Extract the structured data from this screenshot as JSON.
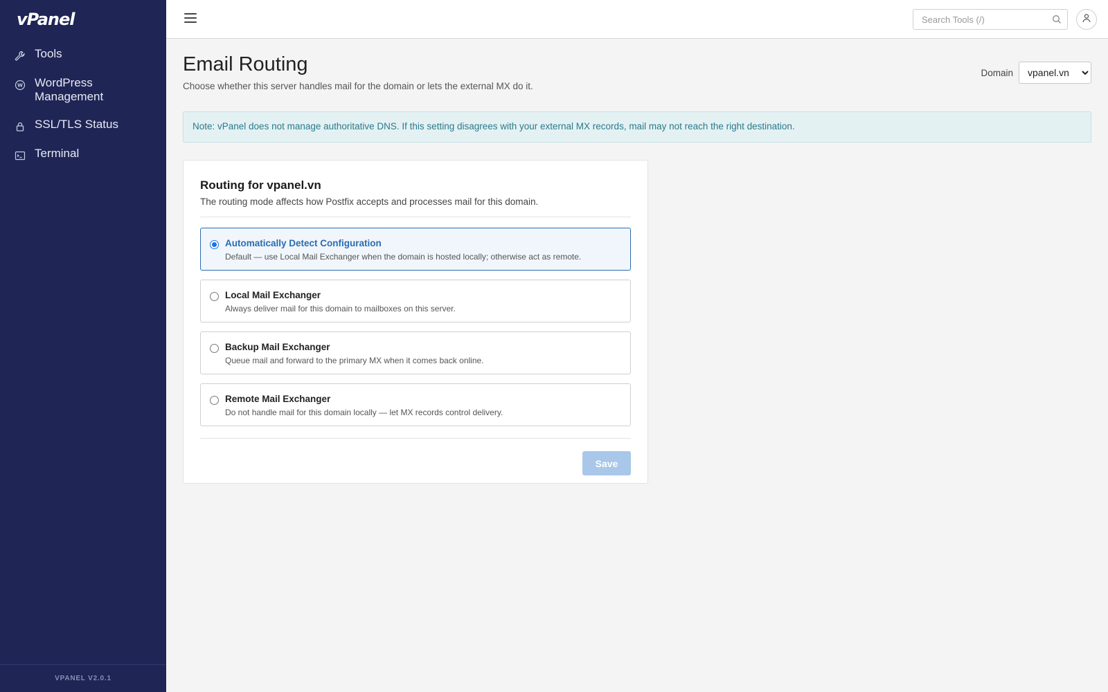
{
  "app": {
    "logo": "vPanel",
    "version": "VPANEL V2.0.1"
  },
  "sidebar": {
    "items": [
      {
        "label": "Tools",
        "icon": "wrench-icon"
      },
      {
        "label": "WordPress Management",
        "icon": "wordpress-icon"
      },
      {
        "label": "SSL/TLS Status",
        "icon": "lock-icon"
      },
      {
        "label": "Terminal",
        "icon": "terminal-icon"
      }
    ]
  },
  "topbar": {
    "search_placeholder": "Search Tools (/)",
    "search_value": ""
  },
  "page": {
    "title": "Email Routing",
    "subtitle": "Choose whether this server handles mail for the domain or lets the external MX do it.",
    "domain_label": "Domain",
    "domain_value": "vpanel.vn",
    "alert": "Note: vPanel does not manage authoritative DNS. If this setting disagrees with your external MX records, mail may not reach the right destination."
  },
  "card": {
    "title": "Routing for vpanel.vn",
    "description": "The routing mode affects how Postfix accepts and processes mail for this domain.",
    "options": [
      {
        "title": "Automatically Detect Configuration",
        "desc": "Default — use Local Mail Exchanger when the domain is hosted locally; otherwise act as remote.",
        "selected": true
      },
      {
        "title": "Local Mail Exchanger",
        "desc": "Always deliver mail for this domain to mailboxes on this server.",
        "selected": false
      },
      {
        "title": "Backup Mail Exchanger",
        "desc": "Queue mail and forward to the primary MX when it comes back online.",
        "selected": false
      },
      {
        "title": "Remote Mail Exchanger",
        "desc": "Do not handle mail for this domain locally — let MX records control delivery.",
        "selected": false
      }
    ],
    "save_label": "Save"
  },
  "colors": {
    "sidebar_bg": "#1f2555",
    "accent": "#2b6cb0",
    "alert_bg": "#e4f1f3",
    "save_disabled": "#a9c7e8"
  }
}
